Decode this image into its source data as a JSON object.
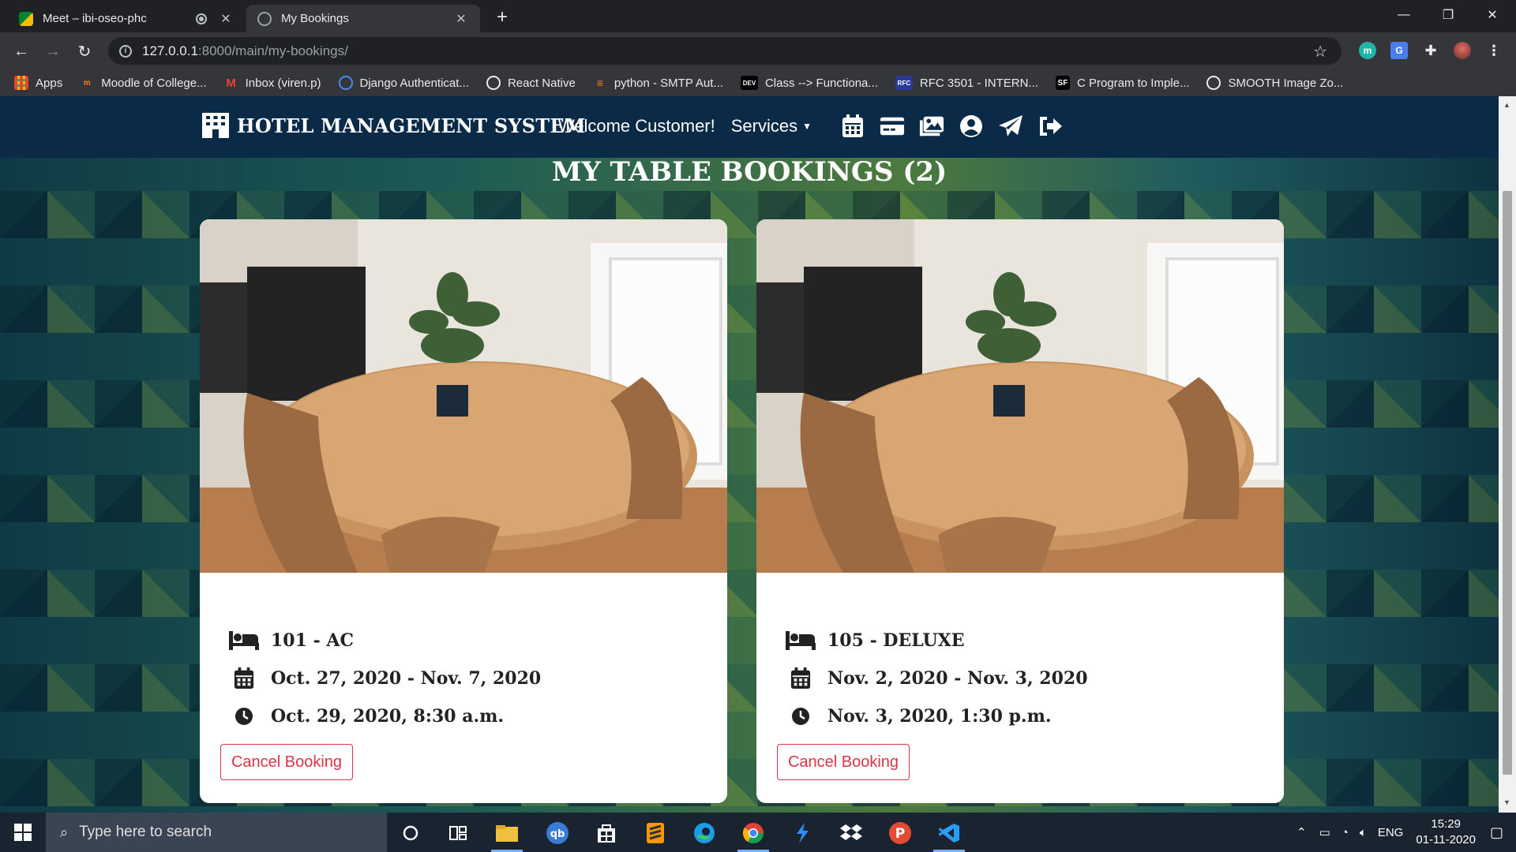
{
  "browser": {
    "tabs": [
      {
        "title": "Meet – ibi-oseo-phc",
        "active": false
      },
      {
        "title": "My Bookings",
        "active": true
      }
    ],
    "url_host": "127.0.0.1",
    "url_path": ":8000/main/my-bookings/",
    "bookmarks": [
      {
        "label": "Apps",
        "icon": "apps-grid-icon"
      },
      {
        "label": "Moodle of College...",
        "icon": "moodle-icon"
      },
      {
        "label": "Inbox (viren.p)",
        "icon": "gmail-icon"
      },
      {
        "label": "Django Authenticat...",
        "icon": "django-icon"
      },
      {
        "label": "React Native",
        "icon": "globe-icon"
      },
      {
        "label": "python - SMTP Aut...",
        "icon": "stackoverflow-icon"
      },
      {
        "label": "Class --> Functiona...",
        "icon": "dev-icon"
      },
      {
        "label": "RFC 3501 - INTERN...",
        "icon": "rfc-icon"
      },
      {
        "label": "C Program to Imple...",
        "icon": "sf-icon"
      },
      {
        "label": "SMOOTH Image Zo...",
        "icon": "globe-icon"
      }
    ]
  },
  "site": {
    "brand": "HOTEL MANAGEMENT SYSTEM",
    "welcome": "Welcome Customer!",
    "services": "Services",
    "nav_icons": [
      "calendar-icon",
      "credit-card-icon",
      "gallery-icon",
      "user-icon",
      "send-icon",
      "logout-icon"
    ]
  },
  "page": {
    "heading": "MY TABLE BOOKINGS (2)"
  },
  "bookings": [
    {
      "room": "101 - AC",
      "dates": "Oct. 27, 2020 - Nov. 7, 2020",
      "time": "Oct. 29, 2020, 8:30 a.m.",
      "cancel_label": "Cancel Booking"
    },
    {
      "room": "105 - DELUXE",
      "dates": "Nov. 2, 2020 - Nov. 3, 2020",
      "time": "Nov. 3, 2020, 1:30 p.m.",
      "cancel_label": "Cancel Booking"
    }
  ],
  "taskbar": {
    "search_placeholder": "Type here to search",
    "language": "ENG",
    "time": "15:29",
    "date": "01-11-2020"
  }
}
